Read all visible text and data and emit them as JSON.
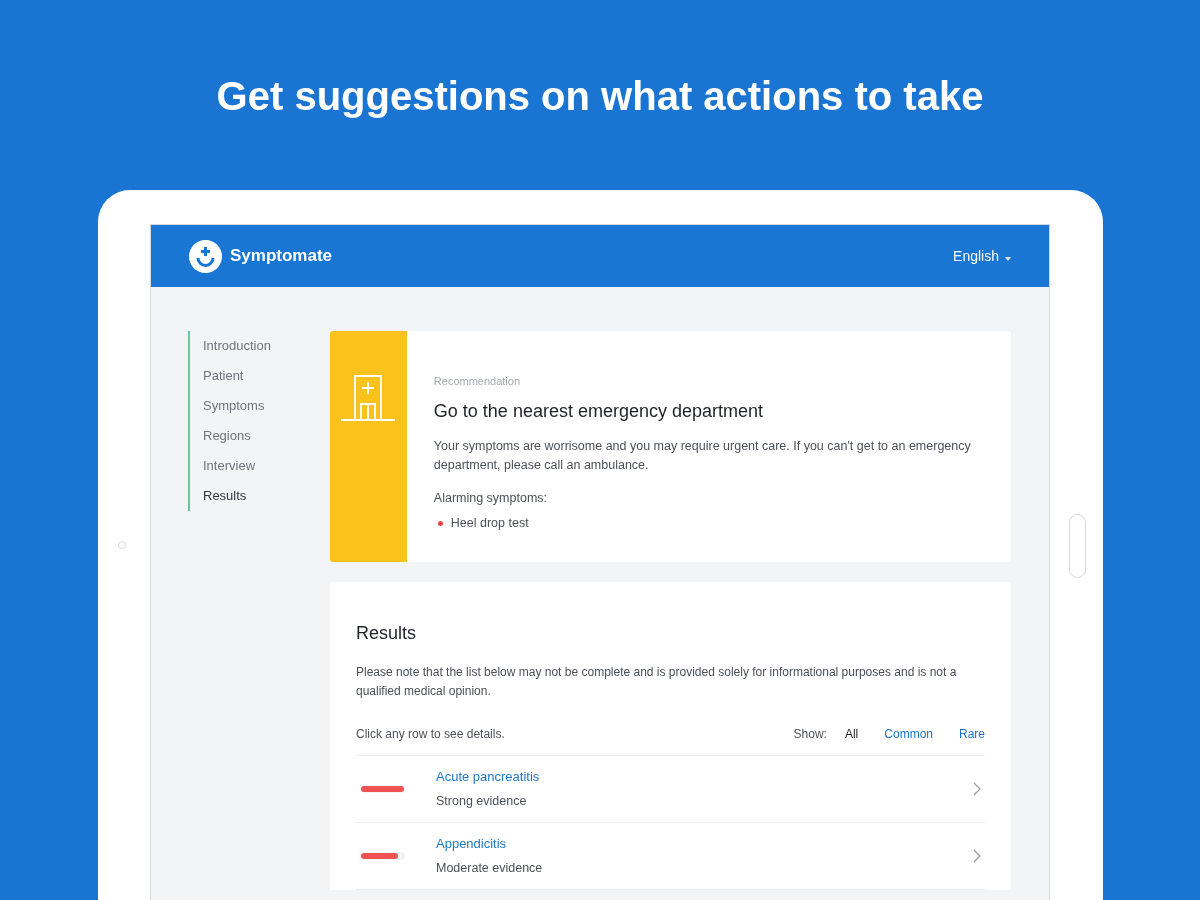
{
  "headline": "Get suggestions on what actions to take",
  "app": {
    "brand": "Symptomate",
    "language": "English"
  },
  "steps": [
    {
      "label": "Introduction",
      "selected": false
    },
    {
      "label": "Patient",
      "selected": false
    },
    {
      "label": "Symptoms",
      "selected": false
    },
    {
      "label": "Regions",
      "selected": false
    },
    {
      "label": "Interview",
      "selected": false
    },
    {
      "label": "Results",
      "selected": true
    }
  ],
  "recommendation": {
    "eyebrow": "Recommendation",
    "title": "Go to the nearest emergency department",
    "text": "Your symptoms are worrisome and you may require urgent care. If you can't get to an emergency department, please call an ambulance.",
    "alarming_label": "Alarming symptoms:",
    "alarming": [
      "Heel drop test"
    ]
  },
  "results": {
    "title": "Results",
    "note": "Please note that the list below may not be complete and is provided solely for informational purposes and is not a qualified medical opinion.",
    "hint": "Click any row to see details.",
    "show_label": "Show:",
    "filters": [
      {
        "label": "All",
        "selected": true
      },
      {
        "label": "Common",
        "selected": false
      },
      {
        "label": "Rare",
        "selected": false
      }
    ],
    "conditions": [
      {
        "name": "Acute pancreatitis",
        "evidence": "Strong evidence",
        "level": 1
      },
      {
        "name": "Appendicitis",
        "evidence": "Moderate evidence",
        "level": 0.85
      }
    ]
  }
}
